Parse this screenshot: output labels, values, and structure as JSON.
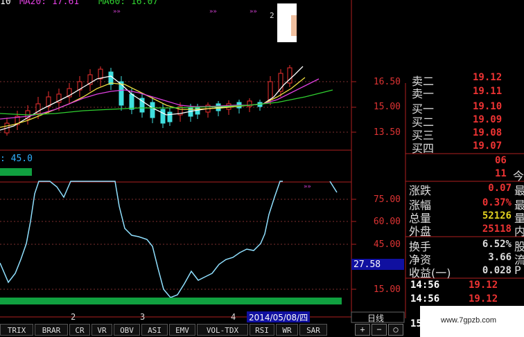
{
  "ma": {
    "ma10_label": "10",
    "ma20_label": "MA20: 17.61",
    "ma60_label": "MA60: 16.07",
    "colors": {
      "ma5": "#ffffff",
      "ma10": "#f0e040",
      "ma20": "#e040e0",
      "ma60": "#30d030"
    }
  },
  "price_axis": [
    "16.50",
    "15.00",
    "13.50"
  ],
  "indicator_axis": [
    "75.00",
    "60.00",
    "45.00",
    "15.00"
  ],
  "indicator_value": "27.58",
  "volume_readout": ": 45.0",
  "date_markers": [
    "2",
    "3",
    "4"
  ],
  "top_marker": "2",
  "date_readout": "2014/05/08/四",
  "period_label": "日线",
  "order_book": [
    {
      "side": "卖二",
      "price": "19.12"
    },
    {
      "side": "卖一",
      "price": "19.11"
    },
    {
      "side": "买一",
      "price": "19.10"
    },
    {
      "side": "买二",
      "price": "19.09"
    },
    {
      "side": "买三",
      "price": "19.08"
    },
    {
      "side": "买四",
      "price": "19.07"
    }
  ],
  "extra_rows": [
    {
      "value": "06",
      "tail": ""
    },
    {
      "value": "11",
      "tail": "今"
    }
  ],
  "stats": [
    {
      "label": "涨跌",
      "value": "0.07",
      "tail": "最"
    },
    {
      "label": "涨幅",
      "value": "0.37%",
      "tail": "最"
    },
    {
      "label": "总量",
      "value": "52126",
      "tail": "量"
    },
    {
      "label": "外盘",
      "value": "25118",
      "tail": "内"
    },
    {
      "label": "换手",
      "value": "6.52%",
      "tail": "股"
    },
    {
      "label": "净资",
      "value": "3.66",
      "tail": "流"
    },
    {
      "label": "收益(一)",
      "value": "0.028",
      "tail": "P"
    }
  ],
  "ticks": [
    {
      "time": "14:56",
      "price": "19.12"
    },
    {
      "time": "14:56",
      "price": "19.12"
    },
    {
      "time": "15",
      "price": ""
    }
  ],
  "watermark": "www.7gpzb.com",
  "tabs": [
    "TRIX",
    "BRAR",
    "CR",
    "VR",
    "OBV",
    "ASI",
    "EMV",
    "VOL-TDX",
    "RSI",
    "WR",
    "SAR"
  ],
  "buttons": [
    "+",
    "−",
    "○"
  ]
}
